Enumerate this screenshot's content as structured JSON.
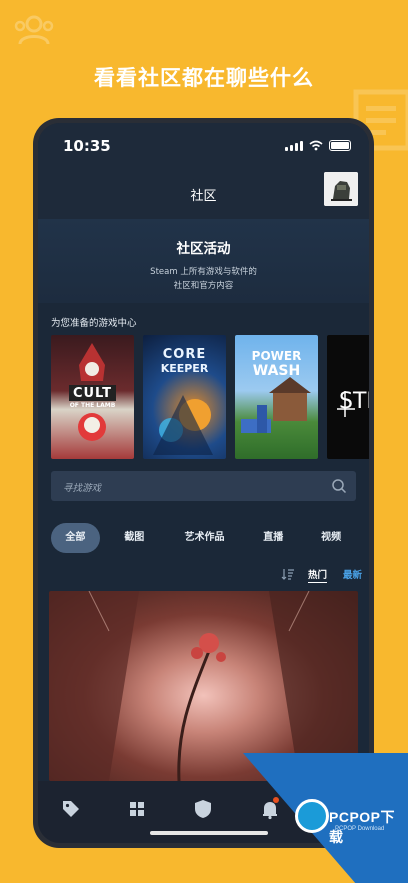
{
  "headline": "看看社区都在聊些什么",
  "status": {
    "time": "10:35"
  },
  "nav": {
    "title": "社区"
  },
  "hero": {
    "title": "社区活动",
    "subtitle_line1": "Steam 上所有游戏与软件的",
    "subtitle_line2": "社区和官方内容"
  },
  "hub": {
    "label": "为您准备的游戏中心",
    "games": [
      {
        "line1": "CULT",
        "line2": "OF THE LAMB"
      },
      {
        "line1": "CORE",
        "line2": "KEEPER"
      },
      {
        "line1": "POWER",
        "line2": "WASH"
      },
      {
        "line1": "STR",
        "line2": ""
      }
    ]
  },
  "search": {
    "placeholder": "寻找游戏"
  },
  "tabs": [
    "全部",
    "截图",
    "艺术作品",
    "直播",
    "视频"
  ],
  "sort": {
    "hot": "热门",
    "new": "最新"
  },
  "watermark": {
    "brand": "PCPOP下载",
    "sub": "PCPOP Download"
  },
  "colors": {
    "background": "#f8b82e",
    "screen": "#1b2838",
    "accent_blue": "#4aa3e8",
    "active_tab": "#4b6380"
  }
}
